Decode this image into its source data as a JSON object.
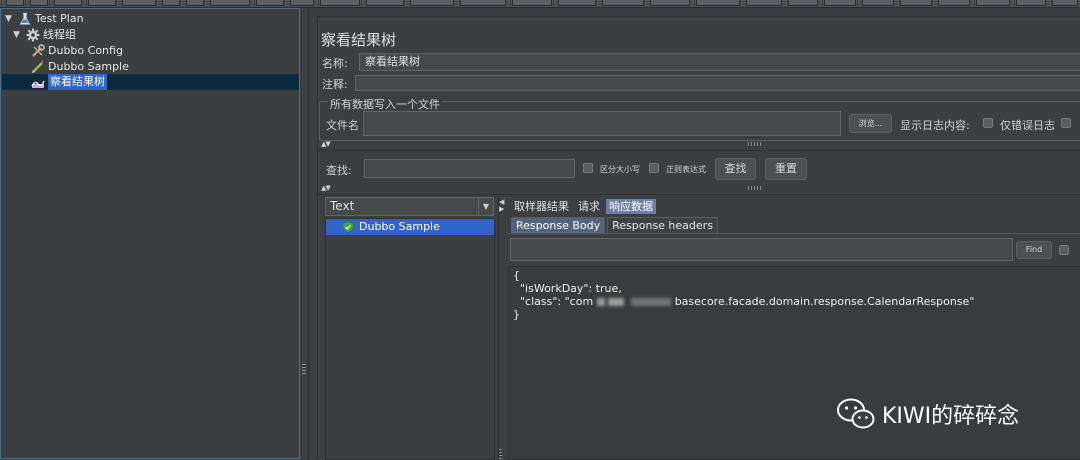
{
  "tree": {
    "items": [
      {
        "label": "Test Plan",
        "icon": "flask-icon",
        "level": 0,
        "expanded": true
      },
      {
        "label": "线程组",
        "icon": "gear-icon",
        "level": 1,
        "expanded": true
      },
      {
        "label": "Dubbo Config",
        "icon": "wrench-icon",
        "level": 2
      },
      {
        "label": "Dubbo Sample",
        "icon": "pen-icon",
        "level": 2
      },
      {
        "label": "察看结果树",
        "icon": "chart-icon",
        "level": 2,
        "selected": true
      }
    ]
  },
  "panel": {
    "title": "察看结果树",
    "name_label": "名称:",
    "name_value": "察看结果树",
    "comment_label": "注释:",
    "comment_value": "",
    "file_group_label": "所有数据写入一个文件",
    "filename_label": "文件名",
    "filename_value": "",
    "browse_label": "浏览...",
    "log_content_label": "显示日志内容:",
    "errors_only_label": "仅错误日志"
  },
  "search": {
    "label": "查找:",
    "value": "",
    "case_sensitive_label": "区分大小写",
    "regex_label": "正则表达式",
    "find_button": "查找",
    "reset_button": "重置"
  },
  "results": {
    "renderer": "Text",
    "samples": [
      {
        "label": "Dubbo Sample",
        "status": "success"
      }
    ],
    "tabs": [
      "取样器结果",
      "请求",
      "响应数据"
    ],
    "active_tab": "响应数据",
    "subtabs": [
      "Response Body",
      "Response headers"
    ],
    "active_subtab": "Response Body",
    "find_button": "Find",
    "find_value": "",
    "body_line1": "{",
    "body_line2_a": "  \"isWorkDay\": true,",
    "body_line3_a": "  \"class\": \"com",
    "body_line3_b": "basecore.facade.domain.response.CalendarResponse\"",
    "body_line4": "}"
  },
  "watermark": {
    "text": "KIWI的碎碎念"
  },
  "colors": {
    "background": "#3c3f41",
    "selection": "#2f65ca",
    "success": "#3ea843"
  }
}
